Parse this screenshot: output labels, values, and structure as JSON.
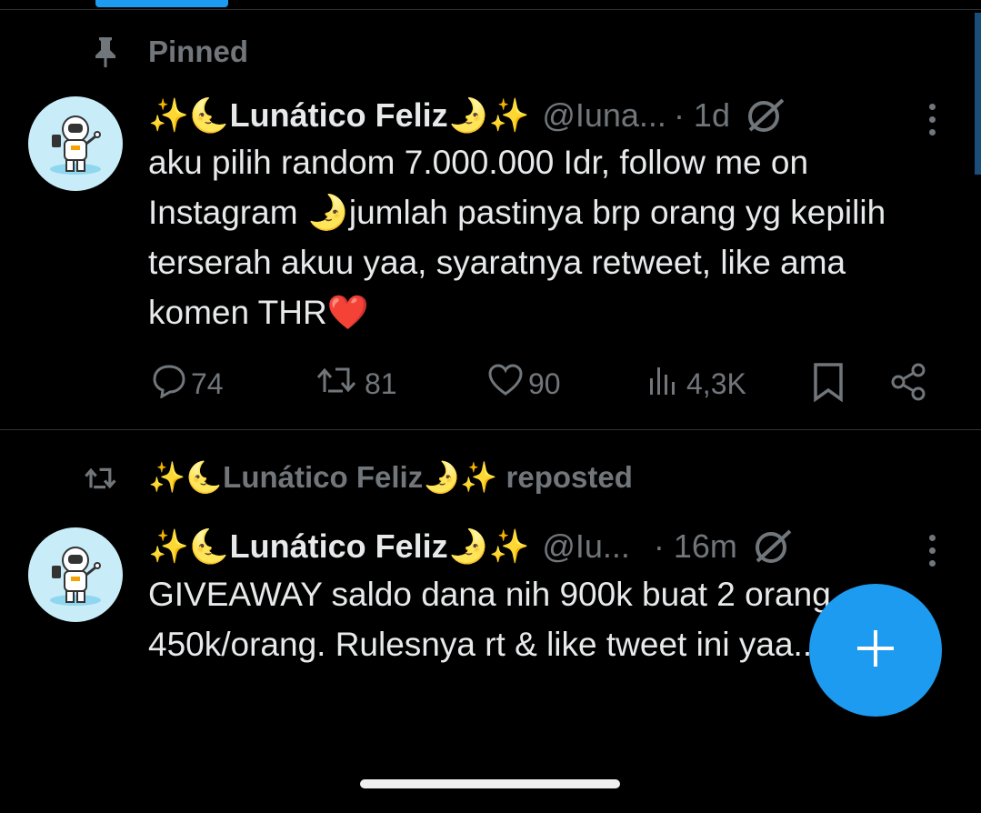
{
  "pinned_label": "Pinned",
  "colors": {
    "accent": "#1d9bf0",
    "muted": "#71767b",
    "text": "#e7e9ea",
    "heart": "#f4212e",
    "background": "#000000"
  },
  "posts": [
    {
      "author_name": "✨🌜Lunático Feliz🌛✨",
      "handle": "@Iuna...",
      "time": "· 1d",
      "text": "aku pilih random 7.000.000 Idr, follow me on Instagram 🌛jumlah pastinya brp orang yg kepilih terserah akuu yaa, syaratnya retweet, like ama komen THR❤️",
      "replies": "74",
      "reposts": "81",
      "likes": "90",
      "views": "4,3K"
    },
    {
      "reposted_by": "✨🌜Lunático Feliz🌛✨ reposted",
      "author_name": "✨🌜Lunático Feliz🌛✨",
      "handle": "@Iu...",
      "time": "· 16m",
      "text": "GIVEAWAY saldo dana nih 900k buat 2 orang, 450k/orang. Rulesnya rt & like tweet ini yaa.."
    }
  ],
  "icons": {
    "pin": "pin-icon",
    "reply": "reply-icon",
    "repost": "repost-icon",
    "like": "heart-icon",
    "views": "views-icon",
    "bookmark": "bookmark-icon",
    "share": "share-icon",
    "grok": "grok-icon",
    "more": "more-vertical-icon",
    "compose": "plus-icon"
  }
}
